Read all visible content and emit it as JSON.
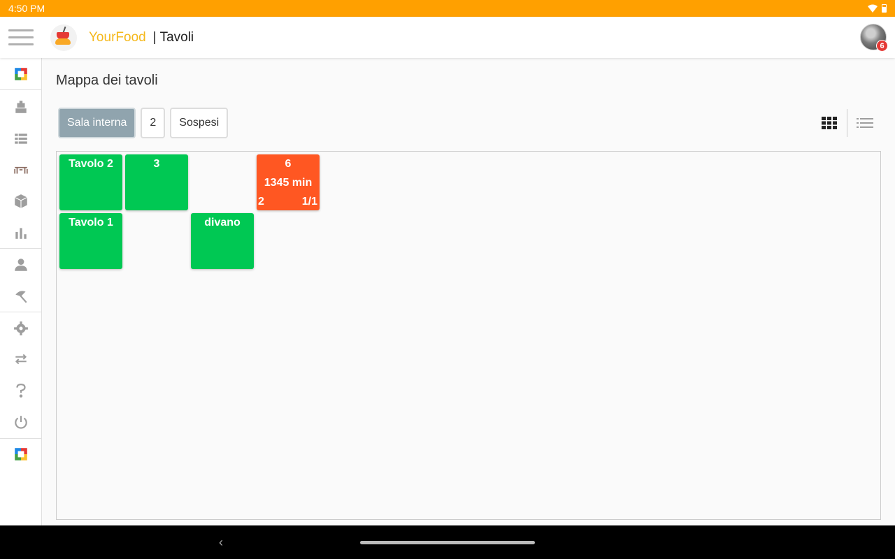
{
  "status_bar": {
    "time": "4:50 PM"
  },
  "header": {
    "brand": "YourFood",
    "section": "| Tavoli",
    "notification_count": "6"
  },
  "sidebar": {
    "items": [
      {
        "icon": "app-logo-icon"
      },
      {
        "icon": "cashier-icon"
      },
      {
        "icon": "list-icon"
      },
      {
        "icon": "tables-icon"
      },
      {
        "icon": "box-icon"
      },
      {
        "icon": "chart-icon"
      },
      {
        "icon": "user-icon"
      },
      {
        "icon": "beach-umbrella-icon"
      },
      {
        "icon": "gear-icon"
      },
      {
        "icon": "swap-icon"
      },
      {
        "icon": "help-icon"
      },
      {
        "icon": "power-icon"
      },
      {
        "icon": "app-logo-icon"
      }
    ]
  },
  "main": {
    "title": "Mappa dei tavoli",
    "tabs": [
      {
        "label": "Sala interna",
        "active": true
      },
      {
        "label": "2",
        "active": false
      },
      {
        "label": "Sospesi",
        "active": false
      }
    ],
    "view_modes": [
      "grid-view-icon",
      "list-view-icon"
    ]
  },
  "tables": [
    {
      "name": "Tavolo 2",
      "status": "free",
      "minutes": "",
      "covers": "",
      "fraction": ""
    },
    {
      "name": "3",
      "status": "free",
      "minutes": "",
      "covers": "",
      "fraction": ""
    },
    {
      "name": "6",
      "status": "occupied",
      "minutes": "1345 min",
      "covers": "2",
      "fraction": "1/1"
    },
    {
      "name": "Tavolo 1",
      "status": "free",
      "minutes": "",
      "covers": "",
      "fraction": ""
    },
    {
      "name": "divano",
      "status": "free",
      "minutes": "",
      "covers": "",
      "fraction": ""
    }
  ],
  "colors": {
    "status_bar": "#ffa000",
    "brand": "#f5b81b",
    "table_free": "#00c853",
    "table_occupied": "#ff5722",
    "tab_active": "#90a4ae"
  }
}
